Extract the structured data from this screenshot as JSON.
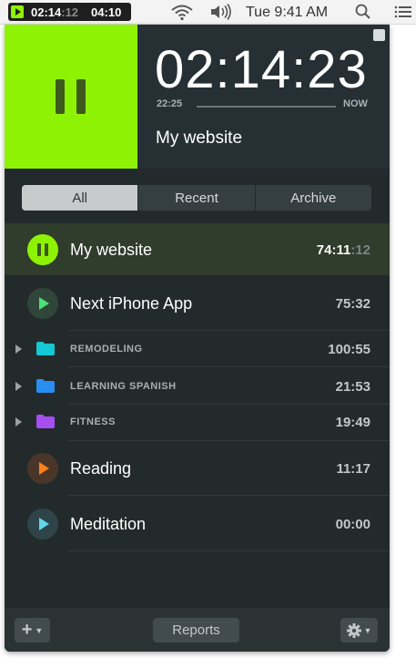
{
  "menubar": {
    "timer_elapsed_main": "02:14",
    "timer_elapsed_seconds": ":12",
    "timer_total": "04:10",
    "clock": "Tue 9:41 AM",
    "icons": [
      "play-icon",
      "wifi-icon",
      "volume-icon",
      "search-icon",
      "list-icon"
    ]
  },
  "header": {
    "big_time": "02:14:23",
    "range_start": "22:25",
    "range_end": "NOW",
    "current_project": "My website",
    "accent_color": "#8ef205"
  },
  "tabs": [
    {
      "label": "All",
      "active": true
    },
    {
      "label": "Recent",
      "active": false
    },
    {
      "label": "Archive",
      "active": false
    }
  ],
  "projects": [
    {
      "name": "My website",
      "time_main": "74:11",
      "time_seconds": ":12",
      "state": "running",
      "color": "#8ef205"
    },
    {
      "name": "Next iPhone App",
      "time": "75:32",
      "state": "stopped",
      "color": "#4be07a"
    },
    {
      "folder": "REMODELING",
      "time": "100:55",
      "color": "#14c8d4"
    },
    {
      "folder": "LEARNING SPANISH",
      "time": "21:53",
      "color": "#2a8ef0"
    },
    {
      "folder": "FITNESS",
      "time": "19:49",
      "color": "#a64ff0"
    },
    {
      "name": "Reading",
      "time": "11:17",
      "state": "stopped",
      "color": "#ff7f1a"
    },
    {
      "name": "Meditation",
      "time": "00:00",
      "state": "stopped",
      "color": "#5fd8e8"
    }
  ],
  "toolbar": {
    "add_label": "+",
    "reports_label": "Reports"
  }
}
